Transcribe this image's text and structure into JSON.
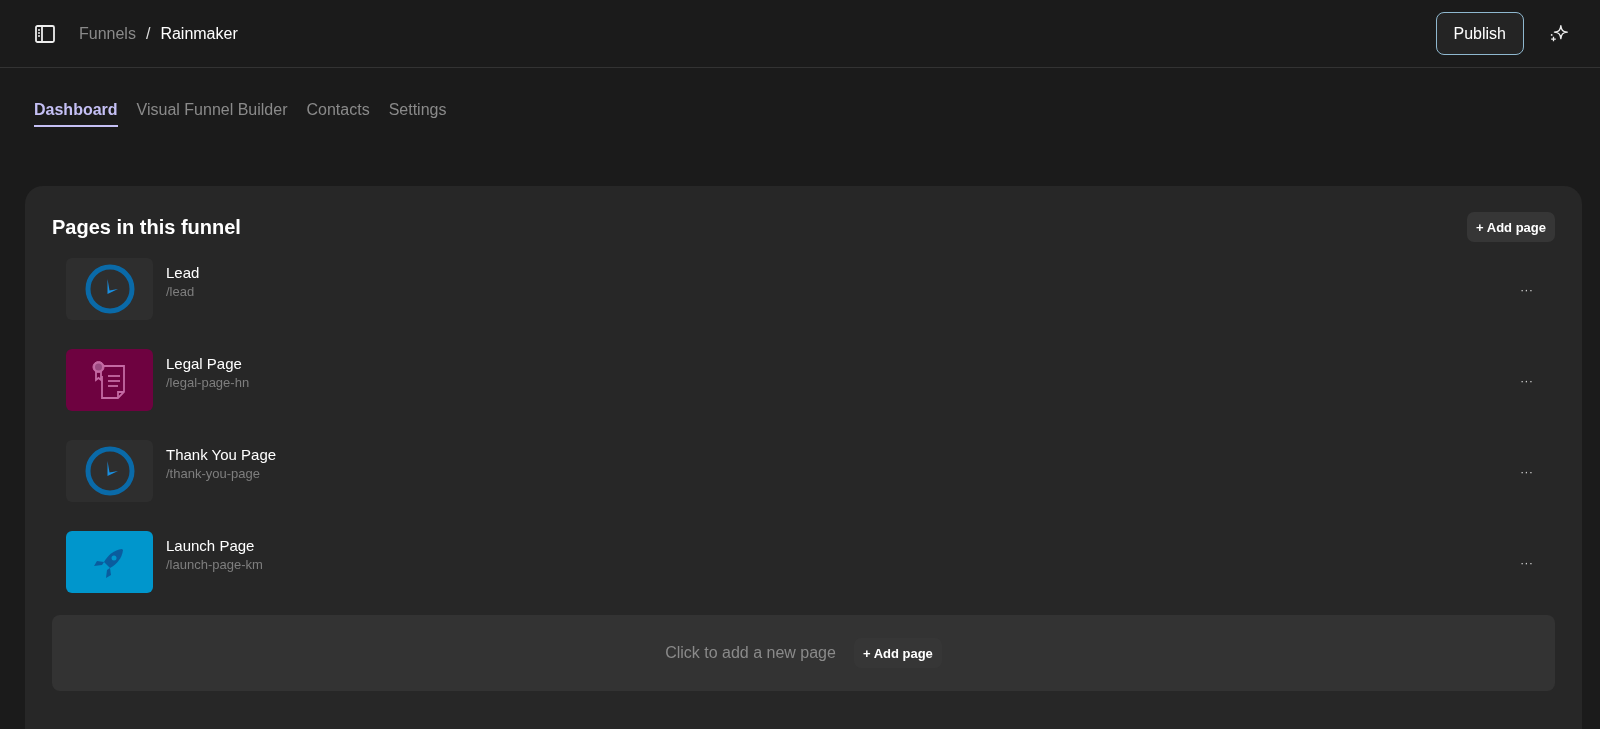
{
  "breadcrumb": {
    "parent": "Funnels",
    "separator": "/",
    "current": "Rainmaker"
  },
  "publish_button": "Publish",
  "tabs": [
    {
      "label": "Dashboard",
      "selected": true
    },
    {
      "label": "Visual Funnel Builder",
      "selected": false
    },
    {
      "label": "Contacts",
      "selected": false
    },
    {
      "label": "Settings",
      "selected": false
    }
  ],
  "pages_panel": {
    "title": "Pages in this funnel",
    "add_button": "+ Add page",
    "pages": [
      {
        "name": "Lead",
        "path": "/lead",
        "kind": "clock",
        "color": "#2e2e2e",
        "menu": "···"
      },
      {
        "name": "Legal Page",
        "path": "/legal-page-hn",
        "kind": "certificate",
        "color": "#6e0240",
        "menu": "···"
      },
      {
        "name": "Thank You Page",
        "path": "/thank-you-page",
        "kind": "clock",
        "color": "#2e2e2e",
        "menu": "···"
      },
      {
        "name": "Launch Page",
        "path": "/launch-page-km",
        "kind": "rocket",
        "color": "#0096cc",
        "menu": "···"
      }
    ],
    "add_area": {
      "hint": "Click to add a new page",
      "button": "+ Add page"
    }
  }
}
